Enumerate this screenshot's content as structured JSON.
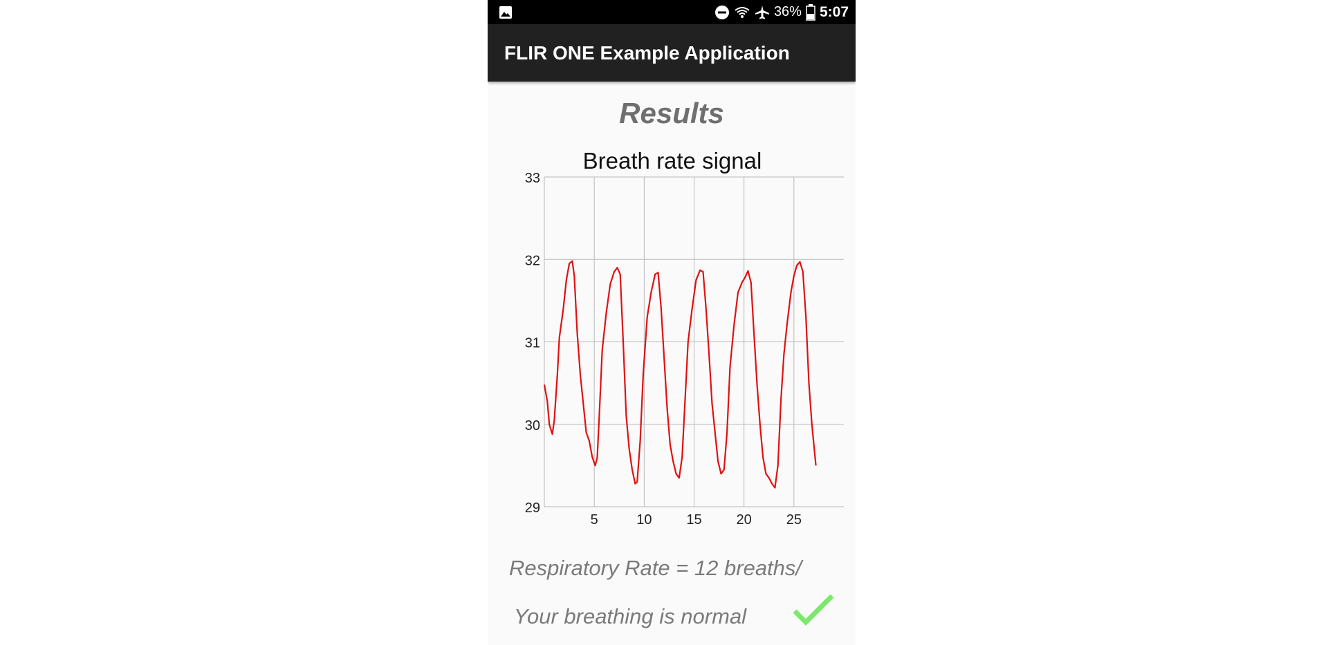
{
  "status_bar": {
    "battery_percent": "36%",
    "time": "5:07",
    "icons": [
      "gallery-icon",
      "do-not-disturb-icon",
      "wifi-icon",
      "airplane-icon",
      "battery-icon"
    ]
  },
  "app_bar": {
    "title": "FLIR ONE Example Application"
  },
  "results": {
    "heading": "Results",
    "respiratory_rate_text": "Respiratory Rate = 12 breaths/",
    "breathing_status": "Your breathing is normal",
    "status_icon": "check-icon",
    "status_color": "#7be86b"
  },
  "chart_data": {
    "type": "line",
    "title": "Breath rate signal",
    "xlabel": "",
    "ylabel": "",
    "xlim": [
      0,
      30
    ],
    "ylim": [
      29,
      33
    ],
    "x_ticks": [
      5,
      10,
      15,
      20,
      25
    ],
    "y_ticks": [
      29,
      30,
      31,
      32,
      33
    ],
    "grid": true,
    "line_color": "#e01010",
    "series": [
      {
        "points": [
          [
            0.0,
            30.48
          ],
          [
            0.3,
            30.28
          ],
          [
            0.5,
            30.0
          ],
          [
            0.8,
            29.88
          ],
          [
            1.0,
            30.05
          ],
          [
            1.3,
            30.6
          ],
          [
            1.5,
            31.05
          ],
          [
            1.9,
            31.4
          ],
          [
            2.2,
            31.75
          ],
          [
            2.5,
            31.95
          ],
          [
            2.8,
            31.98
          ],
          [
            3.0,
            31.8
          ],
          [
            3.3,
            31.1
          ],
          [
            3.6,
            30.6
          ],
          [
            3.9,
            30.25
          ],
          [
            4.2,
            29.9
          ],
          [
            4.5,
            29.8
          ],
          [
            4.8,
            29.6
          ],
          [
            5.1,
            29.5
          ],
          [
            5.3,
            29.6
          ],
          [
            5.5,
            30.1
          ],
          [
            5.8,
            30.9
          ],
          [
            6.2,
            31.35
          ],
          [
            6.6,
            31.7
          ],
          [
            7.0,
            31.85
          ],
          [
            7.3,
            31.9
          ],
          [
            7.6,
            31.82
          ],
          [
            7.9,
            31.0
          ],
          [
            8.2,
            30.1
          ],
          [
            8.5,
            29.7
          ],
          [
            8.8,
            29.45
          ],
          [
            9.1,
            29.28
          ],
          [
            9.3,
            29.3
          ],
          [
            9.6,
            29.8
          ],
          [
            9.9,
            30.6
          ],
          [
            10.3,
            31.3
          ],
          [
            10.7,
            31.6
          ],
          [
            11.1,
            31.82
          ],
          [
            11.4,
            31.84
          ],
          [
            11.7,
            31.4
          ],
          [
            12.0,
            30.8
          ],
          [
            12.3,
            30.2
          ],
          [
            12.6,
            29.75
          ],
          [
            12.9,
            29.55
          ],
          [
            13.2,
            29.4
          ],
          [
            13.5,
            29.35
          ],
          [
            13.8,
            29.6
          ],
          [
            14.1,
            30.3
          ],
          [
            14.4,
            31.0
          ],
          [
            14.8,
            31.4
          ],
          [
            15.2,
            31.75
          ],
          [
            15.6,
            31.87
          ],
          [
            15.9,
            31.85
          ],
          [
            16.2,
            31.4
          ],
          [
            16.5,
            30.85
          ],
          [
            16.8,
            30.25
          ],
          [
            17.1,
            29.9
          ],
          [
            17.4,
            29.55
          ],
          [
            17.7,
            29.4
          ],
          [
            18.0,
            29.45
          ],
          [
            18.3,
            29.9
          ],
          [
            18.6,
            30.7
          ],
          [
            19.0,
            31.2
          ],
          [
            19.4,
            31.6
          ],
          [
            19.8,
            31.72
          ],
          [
            20.1,
            31.78
          ],
          [
            20.4,
            31.86
          ],
          [
            20.7,
            31.72
          ],
          [
            21.0,
            31.1
          ],
          [
            21.3,
            30.5
          ],
          [
            21.6,
            30.0
          ],
          [
            21.9,
            29.6
          ],
          [
            22.2,
            29.4
          ],
          [
            22.5,
            29.35
          ],
          [
            22.8,
            29.28
          ],
          [
            23.1,
            29.23
          ],
          [
            23.4,
            29.5
          ],
          [
            23.7,
            30.3
          ],
          [
            24.0,
            30.85
          ],
          [
            24.3,
            31.2
          ],
          [
            24.7,
            31.6
          ],
          [
            25.0,
            31.8
          ],
          [
            25.3,
            31.93
          ],
          [
            25.6,
            31.97
          ],
          [
            25.9,
            31.85
          ],
          [
            26.2,
            31.3
          ],
          [
            26.5,
            30.5
          ],
          [
            26.8,
            30.0
          ],
          [
            27.0,
            29.75
          ],
          [
            27.2,
            29.5
          ]
        ]
      }
    ]
  }
}
